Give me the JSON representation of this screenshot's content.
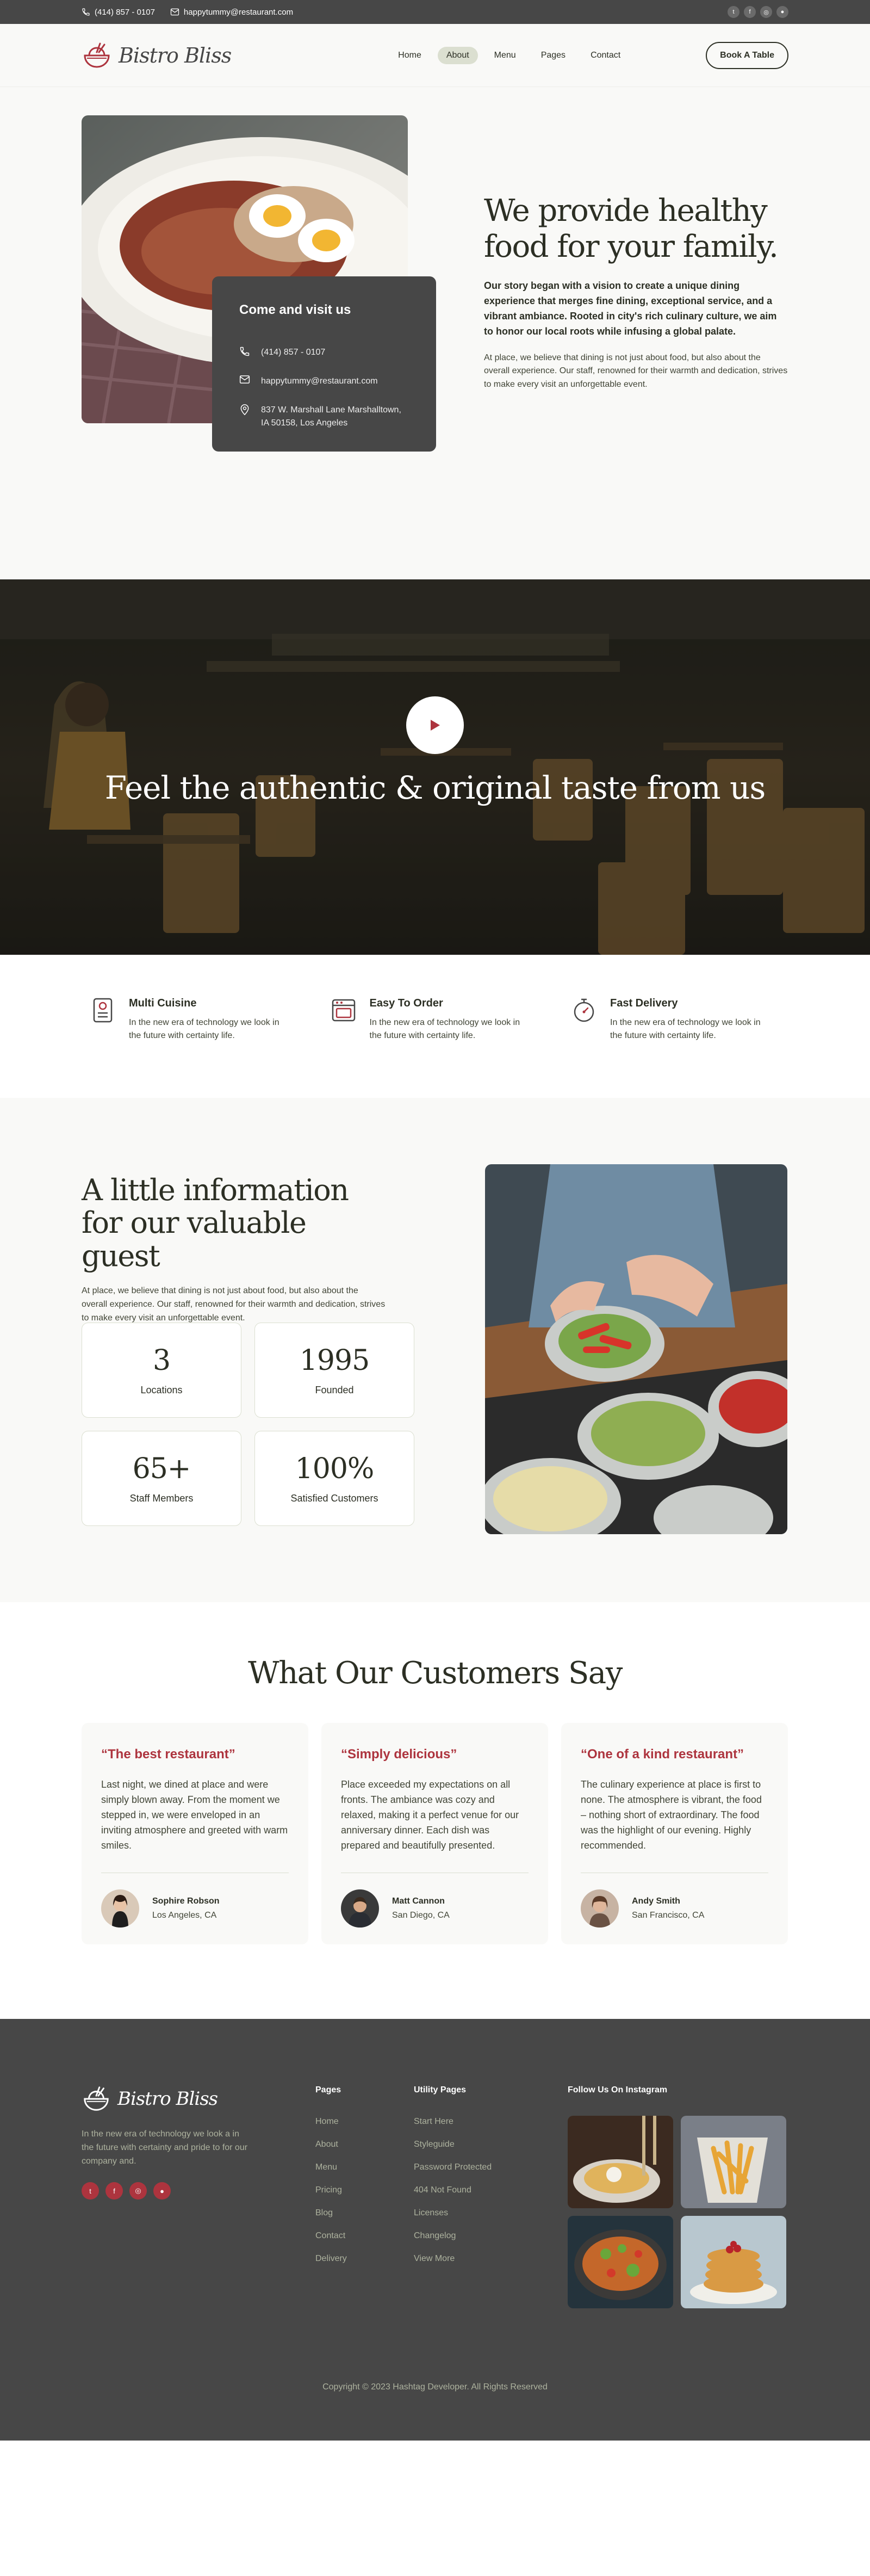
{
  "topbar": {
    "phone": "(414) 857 - 0107",
    "email": "happytummy@restaurant.com",
    "socials": [
      "twitter-icon",
      "facebook-icon",
      "instagram-icon",
      "github-icon"
    ]
  },
  "header": {
    "brand": "Bistro Bliss",
    "nav": [
      "Home",
      "About",
      "Menu",
      "Pages",
      "Contact"
    ],
    "active": "About",
    "cta": "Book A Table"
  },
  "about": {
    "card_title": "Come and visit us",
    "phone": "(414) 857 - 0107",
    "email": "happytummy@restaurant.com",
    "address": "837 W. Marshall Lane Marshalltown, IA 50158, Los Angeles",
    "heading": "We provide healthy food for your family.",
    "lead": "Our story began with a vision to create a unique dining experience that merges fine dining, exceptional service, and a vibrant ambiance. Rooted in city's rich culinary culture, we aim to honor our local roots while infusing a global palate.",
    "body": "At place, we believe that dining is not just about food, but also about the overall experience. Our staff, renowned for their warmth and dedication, strives to make every visit an unforgettable event."
  },
  "banner": {
    "heading": "Feel the authentic & original taste from us"
  },
  "features": [
    {
      "title": "Multi Cuisine",
      "text": "In the new era of technology we look in the future with certainty life.",
      "icon": "menu-card-icon"
    },
    {
      "title": "Easy To Order",
      "text": "In the new era of technology we look in the future with certainty life.",
      "icon": "oven-icon"
    },
    {
      "title": "Fast Delivery",
      "text": "In the new era of technology we look in the future with certainty life.",
      "icon": "stopwatch-icon"
    }
  ],
  "info": {
    "heading": "A little information for our valuable guest",
    "body": "At place, we believe that dining is not just about food, but also about the overall experience. Our staff, renowned for their warmth and dedication, strives to make every visit an unforgettable event.",
    "stats": [
      {
        "value": "3",
        "label": "Locations"
      },
      {
        "value": "1995",
        "label": "Founded"
      },
      {
        "value": "65+",
        "label": "Staff Members"
      },
      {
        "value": "100%",
        "label": "Satisfied Customers"
      }
    ]
  },
  "testimonials": {
    "heading": "What Our Customers Say",
    "items": [
      {
        "title": "“The best restaurant”",
        "text": "Last night, we dined at place and were simply blown away. From the moment we stepped in, we were enveloped in an inviting atmosphere and greeted with warm smiles.",
        "name": "Sophire Robson",
        "location": "Los Angeles, CA"
      },
      {
        "title": "“Simply delicious”",
        "text": "Place exceeded my expectations on all fronts. The ambiance was cozy and relaxed, making it a perfect venue for our anniversary dinner. Each dish was prepared and beautifully presented.",
        "name": "Matt Cannon",
        "location": "San Diego, CA"
      },
      {
        "title": "“One of a kind restaurant”",
        "text": "The culinary experience at place is first to none. The atmosphere is vibrant, the food – nothing short of extraordinary. The food was the highlight of our evening. Highly recommended.",
        "name": "Andy Smith",
        "location": "San Francisco, CA"
      }
    ]
  },
  "footer": {
    "brand": "Bistro Bliss",
    "tagline": "In the new era of technology we look a in the future with certainty and pride to for our company and.",
    "socials": [
      "twitter-icon",
      "facebook-icon",
      "instagram-icon",
      "github-icon"
    ],
    "pages_title": "Pages",
    "pages": [
      "Home",
      "About",
      "Menu",
      "Pricing",
      "Blog",
      "Contact",
      "Delivery"
    ],
    "utility_title": "Utility Pages",
    "utility": [
      "Start Here",
      "Styleguide",
      "Password Protected",
      "404 Not Found",
      "Licenses",
      "Changelog",
      "View More"
    ],
    "instagram_title": "Follow Us On Instagram",
    "copyright": "Copyright © 2023 Hashtag Developer. All Rights Reserved"
  },
  "colors": {
    "accent": "#AD343E",
    "dark": "#474747",
    "text": "#2C2F24",
    "light_bg": "#F9F9F7",
    "nav_active": "#DBDFD0"
  }
}
